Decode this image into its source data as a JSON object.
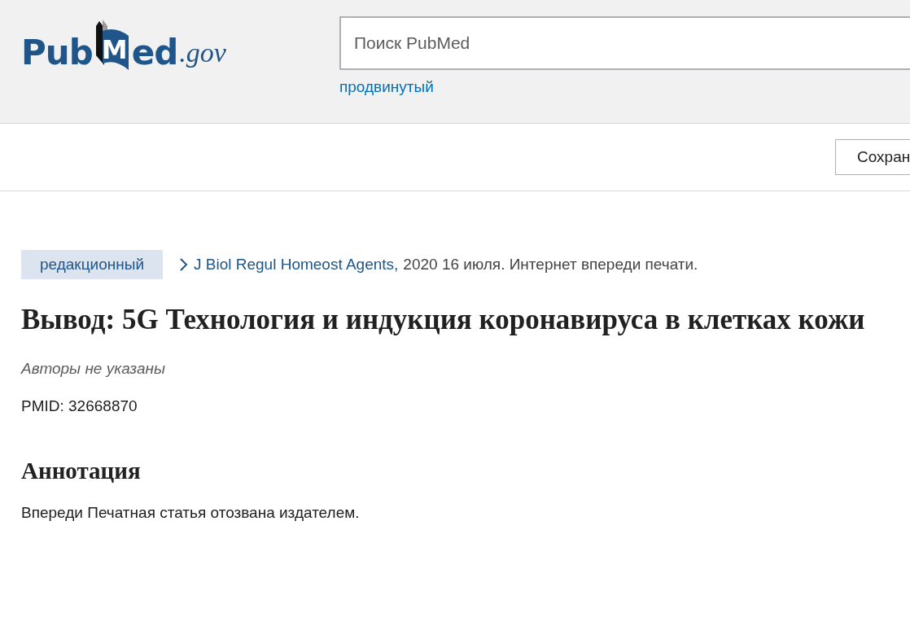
{
  "logo": {
    "before": "Pub",
    "mark": "M",
    "after": "ed",
    "domain": ".gov"
  },
  "search": {
    "placeholder": "Поиск PubMed"
  },
  "advanced_link": "продвинутый",
  "toolbar": {
    "save_button": "Сохран"
  },
  "article": {
    "type_badge": "редакционный",
    "journal": "J Biol Regul Homeost Agents,",
    "pub_info": "2020 16 июля. Интернет впереди печати.",
    "title": "Вывод: 5G Технология и индукция коронавируса в клетках кожи",
    "authors": "Авторы не указаны",
    "pmid": "PMID: 32668870"
  },
  "abstract": {
    "heading": "Аннотация",
    "text": "Впереди Печатная статья отозвана издателем."
  }
}
